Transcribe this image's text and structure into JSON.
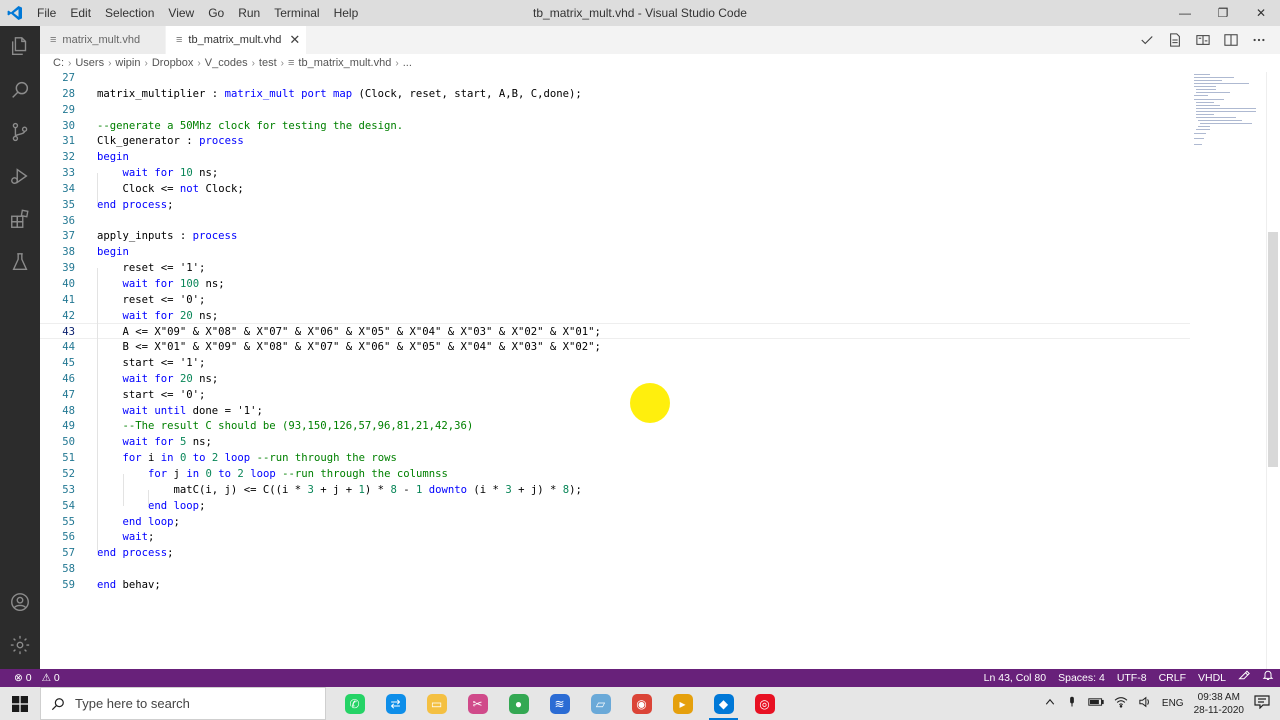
{
  "app": {
    "window_title": "tb_matrix_mult.vhd - Visual Studio Code",
    "menus": [
      "File",
      "Edit",
      "Selection",
      "View",
      "Go",
      "Run",
      "Terminal",
      "Help"
    ],
    "window_controls": [
      "—",
      "❐",
      "✕"
    ]
  },
  "activity_bar": {
    "top_icons": [
      "files-icon",
      "search-icon",
      "source-control-icon",
      "run-debug-icon",
      "extensions-icon",
      "testing-icon"
    ],
    "bottom_icons": [
      "account-icon",
      "settings-gear-icon"
    ]
  },
  "tabs": [
    {
      "label": "matrix_mult.vhd",
      "icon": "≡",
      "active": false
    },
    {
      "label": "tb_matrix_mult.vhd",
      "icon": "≡",
      "active": true,
      "close": "✕"
    }
  ],
  "breadcrumb": [
    "C:",
    "Users",
    "wipin",
    "Dropbox",
    "V_codes",
    "test",
    "tb_matrix_mult.vhd",
    "..."
  ],
  "editor": {
    "current_line": 43,
    "lines": [
      {
        "n": "27",
        "html": ""
      },
      {
        "n": "28",
        "html": "matrix_multiplier : <span class=\"kw\">matrix_mult</span> <span class=\"kw\">port map</span> (Clock, reset, start, A,B, C,done);"
      },
      {
        "n": "29",
        "html": ""
      },
      {
        "n": "30",
        "html": "<span class=\"cm\">--generate a 50Mhz clock for testing the design.</span>"
      },
      {
        "n": "31",
        "html": "Clk_generator : <span class=\"kw\">process</span>"
      },
      {
        "n": "32",
        "html": "<span class=\"kw\">begin</span>"
      },
      {
        "n": "33",
        "html": "    <span class=\"kw\">wait for</span> <span class=\"nm\">10</span> ns;"
      },
      {
        "n": "34",
        "html": "    Clock &lt;= <span class=\"kw\">not</span> Clock;"
      },
      {
        "n": "35",
        "html": "<span class=\"kw\">end process</span>;"
      },
      {
        "n": "36",
        "html": ""
      },
      {
        "n": "37",
        "html": "apply_inputs : <span class=\"kw\">process</span>"
      },
      {
        "n": "38",
        "html": "<span class=\"kw\">begin</span>"
      },
      {
        "n": "39",
        "html": "    reset &lt;= '1';"
      },
      {
        "n": "40",
        "html": "    <span class=\"kw\">wait for</span> <span class=\"nm\">100</span> ns;"
      },
      {
        "n": "41",
        "html": "    reset &lt;= '0';"
      },
      {
        "n": "42",
        "html": "    <span class=\"kw\">wait for</span> <span class=\"nm\">20</span> ns;"
      },
      {
        "n": "43",
        "html": "    A &lt;= X\"09\" &amp; X\"08\" &amp; X\"07\" &amp; X\"06\" &amp; X\"05\" &amp; X\"04\" &amp; X\"03\" &amp; X\"02\" &amp; X\"01\";"
      },
      {
        "n": "44",
        "html": "    B &lt;= X\"01\" &amp; X\"09\" &amp; X\"08\" &amp; X\"07\" &amp; X\"06\" &amp; X\"05\" &amp; X\"04\" &amp; X\"03\" &amp; X\"02\";"
      },
      {
        "n": "45",
        "html": "    start &lt;= '1';"
      },
      {
        "n": "46",
        "html": "    <span class=\"kw\">wait for</span> <span class=\"nm\">20</span> ns;"
      },
      {
        "n": "47",
        "html": "    start &lt;= '0';"
      },
      {
        "n": "48",
        "html": "    <span class=\"kw\">wait until</span> done = '1';"
      },
      {
        "n": "49",
        "html": "    <span class=\"cm\">--The result C should be (93,150,126,57,96,81,21,42,36)</span>"
      },
      {
        "n": "50",
        "html": "    <span class=\"kw\">wait for</span> <span class=\"nm\">5</span> ns;"
      },
      {
        "n": "51",
        "html": "    <span class=\"kw\">for</span> i <span class=\"kw\">in</span> <span class=\"nm\">0</span> <span class=\"kw\">to</span> <span class=\"nm\">2</span> <span class=\"kw\">loop</span> <span class=\"cm\">--run through the rows</span>"
      },
      {
        "n": "52",
        "html": "        <span class=\"kw\">for</span> j <span class=\"kw\">in</span> <span class=\"nm\">0</span> <span class=\"kw\">to</span> <span class=\"nm\">2</span> <span class=\"kw\">loop</span> <span class=\"cm\">--run through the columnss</span>"
      },
      {
        "n": "53",
        "html": "            matC(i, j) &lt;= C((i * <span class=\"nm\">3</span> + j + <span class=\"nm\">1</span>) * <span class=\"nm\">8</span> - <span class=\"nm\">1</span> <span class=\"kw\">downto</span> (i * <span class=\"nm\">3</span> + j) * <span class=\"nm\">8</span>);"
      },
      {
        "n": "54",
        "html": "        <span class=\"kw\">end loop</span>;"
      },
      {
        "n": "55",
        "html": "    <span class=\"kw\">end loop</span>;"
      },
      {
        "n": "56",
        "html": "    <span class=\"kw\">wait</span>;"
      },
      {
        "n": "57",
        "html": "<span class=\"kw\">end process</span>;"
      },
      {
        "n": "58",
        "html": ""
      },
      {
        "n": "59",
        "html": "<span class=\"kw\">end</span> behav;"
      }
    ]
  },
  "status_bar": {
    "errors": "⊗ 0",
    "warnings": "⚠ 0",
    "position": "Ln 43, Col 80",
    "spaces": "Spaces: 4",
    "encoding": "UTF-8",
    "eol": "CRLF",
    "language": "VHDL",
    "background": "#68217a"
  },
  "taskbar": {
    "search_placeholder": "Type here to search",
    "apps": [
      {
        "name": "whatsapp-icon",
        "color": "#25d366"
      },
      {
        "name": "teamviewer-icon",
        "color": "#0e8ee9"
      },
      {
        "name": "file-explorer-icon",
        "color": "#f4c042"
      },
      {
        "name": "snipping-tool-icon",
        "color": "#d04a8a"
      },
      {
        "name": "maps-icon",
        "color": "#34a853"
      },
      {
        "name": "wifi-app-icon",
        "color": "#2b6cd4"
      },
      {
        "name": "notes-app-icon",
        "color": "#6aa9d8"
      },
      {
        "name": "chrome-icon",
        "color": "#db4437"
      },
      {
        "name": "plex-icon",
        "color": "#e5a00d"
      },
      {
        "name": "vscode-icon",
        "color": "#0078d7",
        "active": true
      },
      {
        "name": "recorder-icon",
        "color": "#e81123"
      }
    ],
    "tray": {
      "language": "ENG",
      "time": "09:38 AM",
      "date": "28-11-2020"
    }
  }
}
